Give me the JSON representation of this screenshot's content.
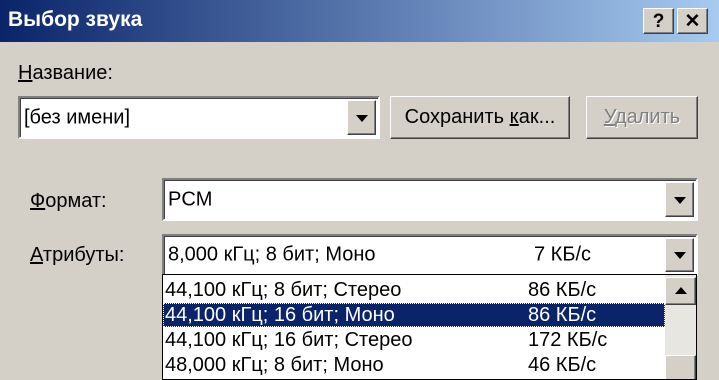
{
  "window": {
    "title": "Выбор звука",
    "help_label": "?",
    "close_label": "✕"
  },
  "name_section": {
    "label_u": "Н",
    "label_rest": "азвание:",
    "value": "[без имени]",
    "save_prefix": "Сохранить ",
    "save_u": "к",
    "save_rest": "ак...",
    "delete_u": "У",
    "delete_rest": "далить"
  },
  "format": {
    "label_u": "Ф",
    "label_rest": "ормат:",
    "value": "PCM"
  },
  "attributes": {
    "label_u": "А",
    "label_rest": "трибуты:",
    "value": "8,000 кГц; 8 бит; Моно",
    "rate": "7 КБ/с",
    "options": [
      {
        "desc": "44,100 кГц; 8 бит; Стерео",
        "rate": "86 КБ/с"
      },
      {
        "desc": "44,100 кГц; 16 бит; Моно",
        "rate": "86 КБ/с"
      },
      {
        "desc": "44,100 кГц; 16 бит; Стерео",
        "rate": "172 КБ/с"
      },
      {
        "desc": "48,000 кГц; 8 бит; Моно",
        "rate": "46 КБ/с"
      }
    ],
    "selected_index": 1
  },
  "icons": {
    "dropdown": "chevron-down-icon",
    "scroll_up": "scroll-up-arrow-icon"
  },
  "colors": {
    "titlebar_start": "#0a246a",
    "titlebar_end": "#a6caf0",
    "selection": "#0a246a",
    "face": "#d4d0c8"
  }
}
